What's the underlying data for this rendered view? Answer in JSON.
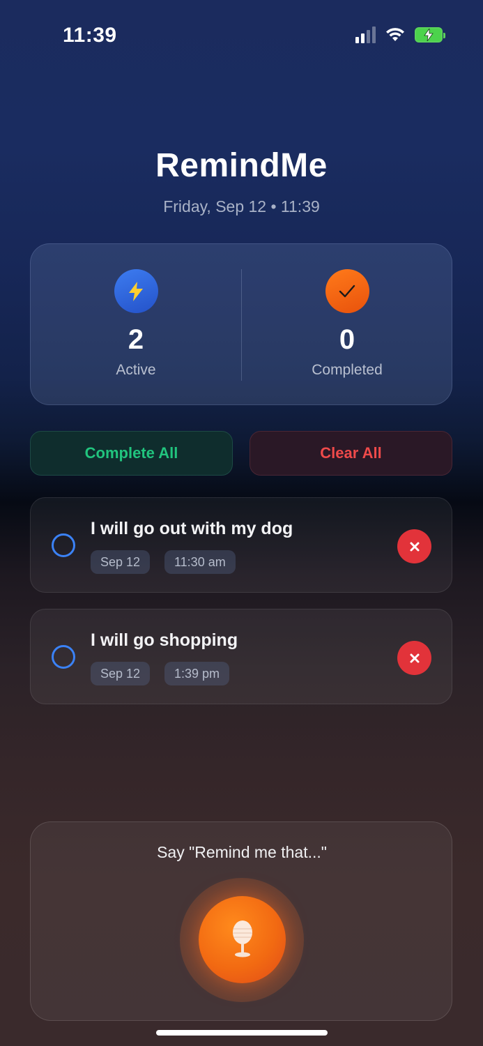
{
  "status_bar": {
    "time": "11:39",
    "signal_icon": "cellular-signal-icon",
    "wifi_icon": "wifi-icon",
    "battery_icon": "battery-charging-icon",
    "battery_color": "#4cd34c"
  },
  "header": {
    "title": "RemindMe",
    "subtitle": "Friday, Sep 12 • 11:39"
  },
  "stats": {
    "active": {
      "icon": "lightning-icon",
      "value": "2",
      "label": "Active",
      "color": "#2f6ae0"
    },
    "completed": {
      "icon": "checkmark-icon",
      "value": "0",
      "label": "Completed",
      "color": "#f26a12"
    }
  },
  "actions": {
    "complete_all_label": "Complete All",
    "complete_all_color": "#21c47e",
    "clear_all_label": "Clear All",
    "clear_all_color": "#ef4a4a"
  },
  "reminders": [
    {
      "text": "I will go out with my dog",
      "date": "Sep 12",
      "time": "11:30 am",
      "completed": false
    },
    {
      "text": "I will go shopping",
      "date": "Sep 12",
      "time": "1:39 pm",
      "completed": false
    }
  ],
  "voice": {
    "prompt": "Say \"Remind me that...\"",
    "mic_icon": "microphone-icon",
    "accent": "#f26a12"
  }
}
